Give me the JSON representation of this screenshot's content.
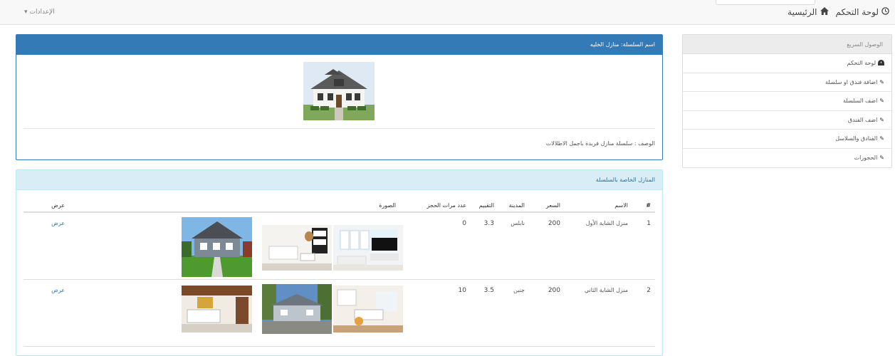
{
  "topbar": {
    "dashboard_label": "لوحة التحكم",
    "home_label": "الرئيسية",
    "settings_label": "الإعدادات",
    "icons": [
      "clock-icon",
      "home-icon",
      "caret-down-icon"
    ]
  },
  "sidebar": {
    "title": "الوصول السريع",
    "items": [
      {
        "label": "لوحة التحكم",
        "icon": "dashboard-icon"
      },
      {
        "label": "اضافة فندق او سلسلة",
        "icon": "pencil-icon"
      },
      {
        "label": "اضف السلسلة",
        "icon": "pencil-icon"
      },
      {
        "label": "اضف الفندق",
        "icon": "pencil-icon"
      },
      {
        "label": "الفنادق والسلاسل",
        "icon": "pencil-icon"
      },
      {
        "label": "الحجوزات",
        "icon": "pencil-icon"
      }
    ]
  },
  "chain": {
    "title": "اسم السلسلة: منازل الخليه",
    "description": "الوصف : سلسلة منازل فريدة باجمل الاطلالات"
  },
  "houses": {
    "title": "المنازل الخاصة بالسلسلة",
    "columns": {
      "num": "#",
      "name": "الاسم",
      "price": "السعر",
      "city": "المدينة",
      "rating": "التقييم",
      "bookings": "عدد مرات الحجز",
      "image": "الصورة",
      "view": "عرض"
    },
    "rows": [
      {
        "num": "1",
        "name": "منزل الشاية الأول",
        "price": "200",
        "city": "نابلس",
        "rating": "3.3",
        "bookings": "0",
        "view": "عرض"
      },
      {
        "num": "2",
        "name": "منزل الشاية الثاني",
        "price": "200",
        "city": "جنين",
        "rating": "3.5",
        "bookings": "10",
        "view": "عرض"
      }
    ]
  },
  "colors": {
    "primary": "#337ab7",
    "info_bg": "#d9edf7",
    "info_text": "#31708f"
  }
}
